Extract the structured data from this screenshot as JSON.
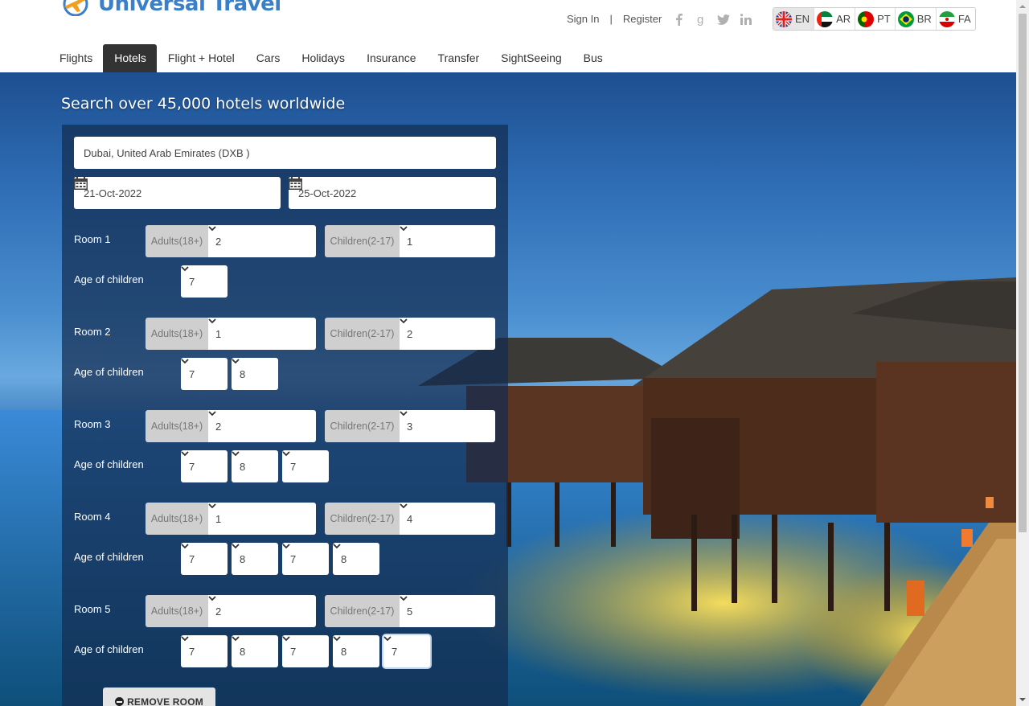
{
  "brand": {
    "name": "Universal Travel"
  },
  "auth": {
    "sign_in": "Sign In",
    "separator": "|",
    "register": "Register"
  },
  "social": [
    "facebook-icon",
    "google-icon",
    "twitter-icon",
    "linkedin-icon"
  ],
  "languages": [
    {
      "code": "EN",
      "active": true
    },
    {
      "code": "AR",
      "active": false
    },
    {
      "code": "PT",
      "active": false
    },
    {
      "code": "BR",
      "active": false
    },
    {
      "code": "FA",
      "active": false
    }
  ],
  "nav": [
    "Flights",
    "Hotels",
    "Flight + Hotel",
    "Cars",
    "Holidays",
    "Insurance",
    "Transfer",
    "SightSeeing",
    "Bus"
  ],
  "nav_active": "Hotels",
  "hero": {
    "title": "Search over 45,000 hotels worldwide"
  },
  "search": {
    "destination": "Dubai, United Arab Emirates (DXB )",
    "checkin": "21-Oct-2022",
    "checkout": "25-Oct-2022"
  },
  "labels": {
    "adults": "Adults(18+)",
    "children": "Children(2-17)",
    "age_of_children": "Age of children"
  },
  "rooms": [
    {
      "label": "Room 1",
      "adults": "2",
      "children": "1",
      "ages": [
        "7"
      ]
    },
    {
      "label": "Room 2",
      "adults": "1",
      "children": "2",
      "ages": [
        "7",
        "8"
      ]
    },
    {
      "label": "Room 3",
      "adults": "2",
      "children": "3",
      "ages": [
        "7",
        "8",
        "7"
      ]
    },
    {
      "label": "Room 4",
      "adults": "1",
      "children": "4",
      "ages": [
        "7",
        "8",
        "7",
        "8"
      ]
    },
    {
      "label": "Room 5",
      "adults": "2",
      "children": "5",
      "ages": [
        "7",
        "8",
        "7",
        "8",
        "7"
      ]
    }
  ],
  "remove_room": "REMOVE ROOM",
  "colors": {
    "brand_blue": "#3a7fc8",
    "nav_active_bg": "#333333",
    "panel_bg": "#142d50"
  }
}
